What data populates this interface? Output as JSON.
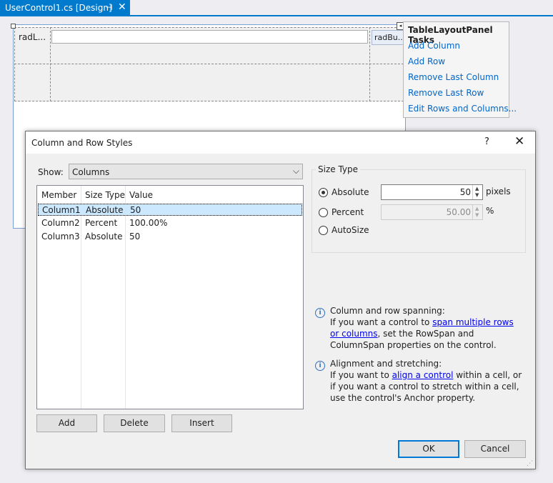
{
  "tab": {
    "title": "UserControl1.cs [Design]",
    "pin": "⊣",
    "close": "✕"
  },
  "designer": {
    "label_text": "radL...",
    "button_text": "radBu..."
  },
  "smart_tag": {
    "title": "TableLayoutPanel Tasks",
    "links": [
      "Add Column",
      "Add Row",
      "Remove Last Column",
      "Remove Last Row",
      "Edit Rows and Columns..."
    ]
  },
  "dialog": {
    "title": "Column and Row Styles",
    "help": "?",
    "close": "✕",
    "show_label": "Show:",
    "show_value": "Columns",
    "list": {
      "headers": [
        "Member",
        "Size Type",
        "Value"
      ],
      "rows": [
        [
          "Column1",
          "Absolute",
          "50"
        ],
        [
          "Column2",
          "Percent",
          "100.00%"
        ],
        [
          "Column3",
          "Absolute",
          "50"
        ]
      ],
      "selected_row": 0
    },
    "buttons": {
      "add": "Add",
      "delete": "Delete",
      "insert": "Insert",
      "ok": "OK",
      "cancel": "Cancel"
    },
    "size_type": {
      "group_title": "Size Type",
      "absolute_label": "Absolute",
      "absolute_value": "50",
      "absolute_unit": "pixels",
      "percent_label": "Percent",
      "percent_value": "50.00",
      "percent_unit": "%",
      "autosize_label": "AutoSize",
      "selected": "Absolute"
    },
    "info": {
      "spanning_heading": "Column and row spanning:",
      "spanning_pre": "If you want a control to ",
      "spanning_link": "span multiple rows or columns",
      "spanning_post": ", set the RowSpan and ColumnSpan properties on the control.",
      "align_heading": "Alignment and stretching:",
      "align_pre": "If you want to ",
      "align_link": "align a control",
      "align_post": " within a cell, or if you want a control to stretch within a cell, use the control's Anchor property."
    }
  }
}
